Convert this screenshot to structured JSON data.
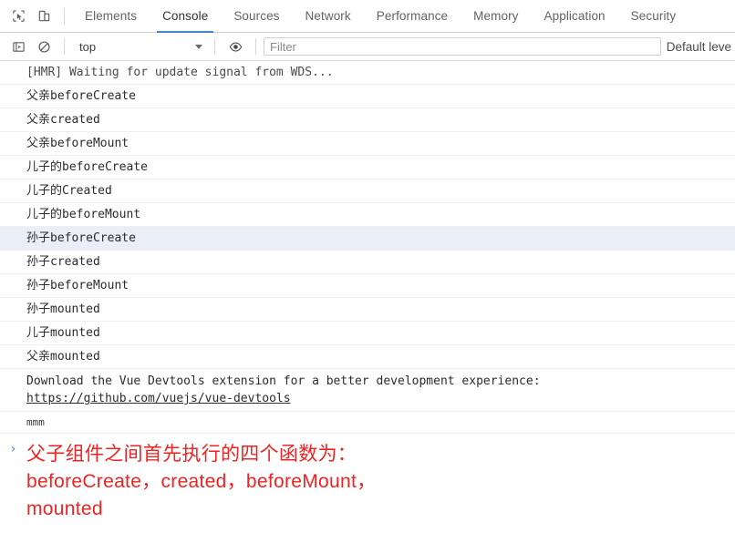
{
  "toolbar": {
    "icons": [
      {
        "name": "inspect-element-icon",
        "title": "Inspect element"
      },
      {
        "name": "device-toolbar-icon",
        "title": "Toggle device toolbar"
      }
    ],
    "tabs": [
      {
        "label": "Elements",
        "active": false
      },
      {
        "label": "Console",
        "active": true
      },
      {
        "label": "Sources",
        "active": false
      },
      {
        "label": "Network",
        "active": false
      },
      {
        "label": "Performance",
        "active": false
      },
      {
        "label": "Memory",
        "active": false
      },
      {
        "label": "Application",
        "active": false
      },
      {
        "label": "Security",
        "active": false
      }
    ]
  },
  "filterbar": {
    "sidebar_icon": "show-console-sidebar-icon",
    "clear_icon": "clear-console-icon",
    "context": "top",
    "eye_icon": "live-expression-eye-icon",
    "filter_placeholder": "Filter",
    "filter_value": "",
    "level": "Default leve"
  },
  "console": {
    "rows": [
      {
        "text": "[HMR] Waiting for update signal from WDS...",
        "style": "hmr",
        "selected": false
      },
      {
        "text": "父亲beforeCreate",
        "style": "normal",
        "selected": false
      },
      {
        "text": "父亲created",
        "style": "normal",
        "selected": false
      },
      {
        "text": "父亲beforeMount",
        "style": "normal",
        "selected": false
      },
      {
        "text": "儿子的beforeCreate",
        "style": "normal",
        "selected": false
      },
      {
        "text": "儿子的Created",
        "style": "normal",
        "selected": false
      },
      {
        "text": "儿子的beforeMount",
        "style": "normal",
        "selected": false
      },
      {
        "text": "孙子beforeCreate",
        "style": "normal",
        "selected": true
      },
      {
        "text": "孙子created",
        "style": "normal",
        "selected": false
      },
      {
        "text": "孙子beforeMount",
        "style": "normal",
        "selected": false
      },
      {
        "text": "孙子mounted",
        "style": "normal",
        "selected": false
      },
      {
        "text": "儿子mounted",
        "style": "normal",
        "selected": false
      },
      {
        "text": "父亲mounted",
        "style": "normal",
        "selected": false
      }
    ],
    "devtools_notice": {
      "text": "Download the Vue Devtools extension for a better development experience:",
      "link": "https://github.com/vuejs/vue-devtools"
    },
    "last_row": "mmm"
  },
  "prompt": {
    "chevron": "›",
    "annotation": "父子组件之间首先执行的四个函数为：beforeCreate，created，beforeMount，mounted"
  },
  "colors": {
    "accent": "#4286c5",
    "annotation_red": "#ee2323",
    "selected_row": "#eaeef8",
    "chevron_blue": "#4a7ebb"
  }
}
